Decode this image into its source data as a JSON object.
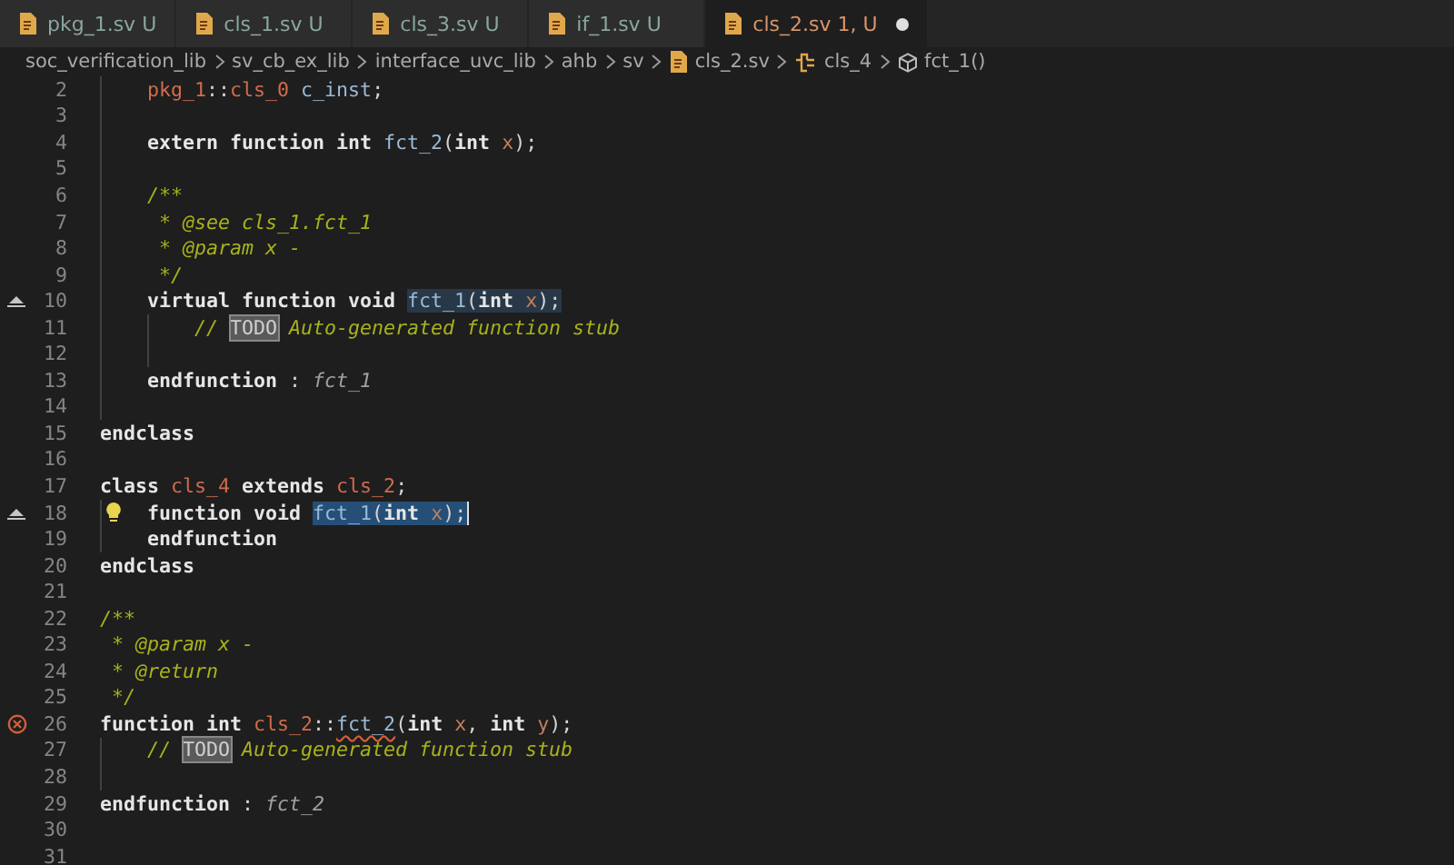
{
  "tabs": [
    {
      "name": "pkg_1.sv",
      "status": "U",
      "selected": false,
      "modified": false
    },
    {
      "name": "cls_1.sv",
      "status": "U",
      "selected": false,
      "modified": false
    },
    {
      "name": "cls_3.sv",
      "status": "U",
      "selected": false,
      "modified": false
    },
    {
      "name": "if_1.sv",
      "status": "U",
      "selected": false,
      "modified": false
    },
    {
      "name": "cls_2.sv",
      "status": "1, U",
      "selected": true,
      "modified": true
    }
  ],
  "breadcrumb": [
    {
      "label": "soc_verification_lib",
      "kind": "folder"
    },
    {
      "label": "sv_cb_ex_lib",
      "kind": "folder"
    },
    {
      "label": "interface_uvc_lib",
      "kind": "folder"
    },
    {
      "label": "ahb",
      "kind": "folder"
    },
    {
      "label": "sv",
      "kind": "folder"
    },
    {
      "label": "cls_2.sv",
      "kind": "file"
    },
    {
      "label": "cls_4",
      "kind": "class"
    },
    {
      "label": "fct_1()",
      "kind": "method"
    }
  ],
  "lines": [
    {
      "number": "2",
      "tokens": [
        {
          "text": "    pkg_1",
          "kind": "type"
        },
        {
          "text": "::",
          "kind": "punct"
        },
        {
          "text": "cls_0",
          "kind": "type"
        },
        {
          "text": " c_inst",
          "kind": "ident"
        },
        {
          "text": ";",
          "kind": "punct"
        }
      ]
    },
    {
      "number": "3"
    },
    {
      "number": "4",
      "tokens": [
        {
          "text": "    extern function int ",
          "kind": "kw"
        },
        {
          "text": "fct_2",
          "kind": "ident"
        },
        {
          "text": "(",
          "kind": "punct"
        },
        {
          "text": "int",
          "kind": "kw"
        },
        {
          "text": " x",
          "kind": "param"
        },
        {
          "text": ");",
          "kind": "punct"
        }
      ]
    },
    {
      "number": "5"
    },
    {
      "number": "6",
      "tokens": [
        {
          "text": "    /**",
          "kind": "comment"
        }
      ]
    },
    {
      "number": "7",
      "tokens": [
        {
          "text": "     * @see cls_1.fct_1",
          "kind": "comment"
        }
      ]
    },
    {
      "number": "8",
      "tokens": [
        {
          "text": "     * @param x -",
          "kind": "comment"
        }
      ]
    },
    {
      "number": "9",
      "tokens": [
        {
          "text": "     */",
          "kind": "comment"
        }
      ]
    },
    {
      "number": "10",
      "markers": [
        {
          "kind": "override"
        }
      ],
      "tokens": [
        {
          "text": "    virtual function void ",
          "kind": "kw",
          "occurrence": false
        },
        {
          "text": "fct_1",
          "kind": "ident",
          "occurrence": true
        },
        {
          "text": "(",
          "kind": "punct",
          "occurrence": true
        },
        {
          "text": "int",
          "kind": "kw",
          "occurrence": true
        },
        {
          "text": " x",
          "kind": "param",
          "occurrence": true
        },
        {
          "text": ");",
          "kind": "punct",
          "occurrence": true
        }
      ]
    },
    {
      "number": "11",
      "tokens": [
        {
          "text": "        // ",
          "kind": "comment"
        },
        {
          "text": "TODO",
          "kind": "todo"
        },
        {
          "text": " Auto-generated function stub",
          "kind": "comment"
        }
      ]
    },
    {
      "number": "12"
    },
    {
      "number": "13",
      "tokens": [
        {
          "text": "    endfunction",
          "kind": "kw"
        },
        {
          "text": " : ",
          "kind": "punct"
        },
        {
          "text": "fct_1",
          "kind": "label"
        }
      ]
    },
    {
      "number": "14"
    },
    {
      "number": "15",
      "tokens": [
        {
          "text": "endclass",
          "kind": "kw"
        }
      ]
    },
    {
      "number": "16"
    },
    {
      "number": "17",
      "tokens": [
        {
          "text": "class ",
          "kind": "kw"
        },
        {
          "text": "cls_4",
          "kind": "type"
        },
        {
          "text": " extends ",
          "kind": "kw"
        },
        {
          "text": "cls_2",
          "kind": "type"
        },
        {
          "text": ";",
          "kind": "punct"
        }
      ]
    },
    {
      "number": "18",
      "markers": [
        {
          "kind": "override"
        },
        {
          "kind": "lightbulb"
        }
      ],
      "tokens": [
        {
          "text": "    function void ",
          "kind": "kw",
          "selected": false
        },
        {
          "text": "fct_1",
          "kind": "ident",
          "selected": true
        },
        {
          "text": "(",
          "kind": "punct",
          "selected": true
        },
        {
          "text": "int",
          "kind": "kw",
          "selected": true
        },
        {
          "text": " x",
          "kind": "param",
          "selected": true
        },
        {
          "text": ");",
          "kind": "punct",
          "selected": true
        }
      ]
    },
    {
      "number": "19",
      "tokens": [
        {
          "text": "    endfunction",
          "kind": "kw"
        }
      ]
    },
    {
      "number": "20",
      "tokens": [
        {
          "text": "endclass",
          "kind": "kw"
        }
      ]
    },
    {
      "number": "21"
    },
    {
      "number": "22",
      "tokens": [
        {
          "text": "/**",
          "kind": "comment"
        }
      ]
    },
    {
      "number": "23",
      "tokens": [
        {
          "text": " * @param x -",
          "kind": "comment"
        }
      ]
    },
    {
      "number": "24",
      "tokens": [
        {
          "text": " * @return",
          "kind": "comment"
        }
      ]
    },
    {
      "number": "25",
      "tokens": [
        {
          "text": " */",
          "kind": "comment"
        }
      ]
    },
    {
      "number": "26",
      "markers": [
        {
          "kind": "error"
        }
      ],
      "tokens": [
        {
          "text": "function int ",
          "kind": "kw"
        },
        {
          "text": "cls_2",
          "kind": "type"
        },
        {
          "text": "::",
          "kind": "punct"
        },
        {
          "text": "fct_2",
          "kind": "error"
        },
        {
          "text": "(",
          "kind": "punct"
        },
        {
          "text": "int",
          "kind": "kw"
        },
        {
          "text": " x",
          "kind": "param"
        },
        {
          "text": ", ",
          "kind": "punct"
        },
        {
          "text": "int",
          "kind": "kw"
        },
        {
          "text": " y",
          "kind": "param"
        },
        {
          "text": ");",
          "kind": "punct"
        }
      ]
    },
    {
      "number": "27",
      "tokens": [
        {
          "text": "    // ",
          "kind": "comment"
        },
        {
          "text": "TODO",
          "kind": "todo"
        },
        {
          "text": " Auto-generated function stub",
          "kind": "comment"
        }
      ]
    },
    {
      "number": "28"
    },
    {
      "number": "29",
      "tokens": [
        {
          "text": "endfunction",
          "kind": "kw"
        },
        {
          "text": " : ",
          "kind": "punct"
        },
        {
          "text": "fct_2",
          "kind": "label"
        }
      ]
    },
    {
      "number": "30"
    },
    {
      "number": "31"
    }
  ]
}
